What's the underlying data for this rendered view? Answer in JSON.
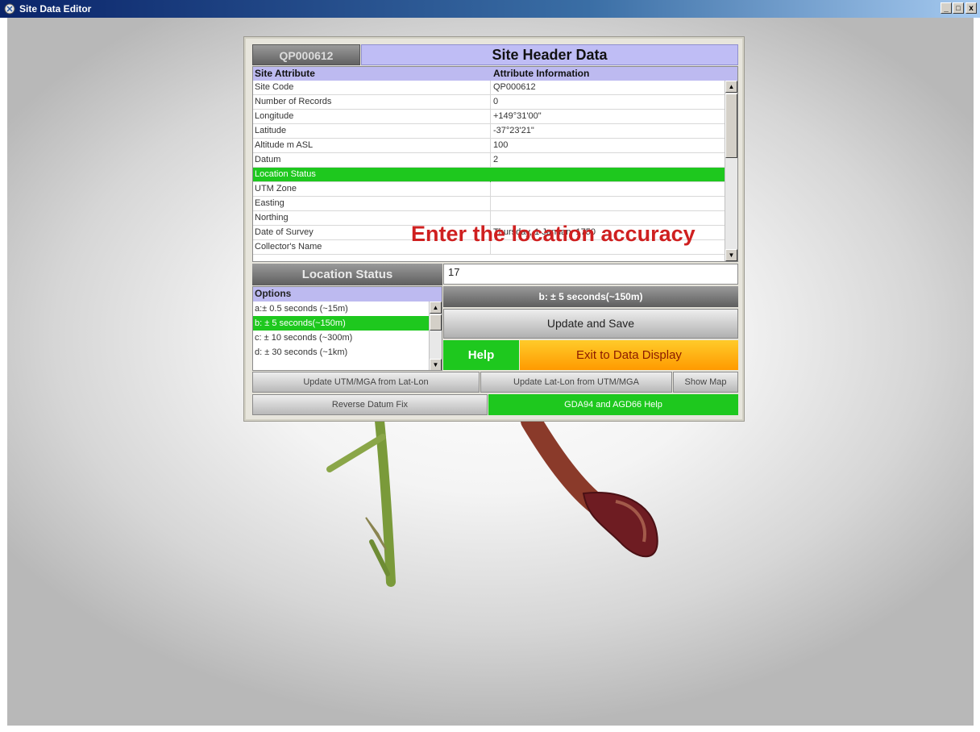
{
  "window": {
    "title": "Site Data Editor",
    "controls": [
      "_",
      "□",
      "x"
    ]
  },
  "header": {
    "site_code": "QP000612",
    "title": "Site Header Data"
  },
  "grid": {
    "columns": [
      "Site Attribute",
      "Attribute Information"
    ],
    "rows": [
      {
        "attribute": "Site Code",
        "value": "QP000612"
      },
      {
        "attribute": "Number of Records",
        "value": "0"
      },
      {
        "attribute": "Longitude",
        "value": "+149°31'00\""
      },
      {
        "attribute": "Latitude",
        "value": "-37°23'21\""
      },
      {
        "attribute": "Altitude m ASL",
        "value": "100"
      },
      {
        "attribute": "Datum",
        "value": "2"
      },
      {
        "attribute": "Location Status",
        "value": "",
        "selected": true
      },
      {
        "attribute": "UTM Zone",
        "value": ""
      },
      {
        "attribute": "Easting",
        "value": ""
      },
      {
        "attribute": "Northing",
        "value": ""
      },
      {
        "attribute": "Date of Survey",
        "value": "Thursday, 1 January 1750"
      },
      {
        "attribute": "Collector's Name",
        "value": ""
      }
    ],
    "prompt": "Enter the location accuracy"
  },
  "location": {
    "label": "Location Status",
    "input_value": "17",
    "options_header": "Options",
    "options": [
      "a:± 0.5 seconds (~15m)",
      "b: ± 5 seconds(~150m)",
      "c: ± 10 seconds (~300m)",
      "d: ± 30 seconds (~1km)"
    ],
    "selected_option_index": 1,
    "selected_display": "b: ± 5 seconds(~150m)"
  },
  "buttons": {
    "update_save": "Update and Save",
    "help": "Help",
    "exit": "Exit to Data Display",
    "update_utm": "Update UTM/MGA from Lat-Lon",
    "update_latlon": "Update Lat-Lon from UTM/MGA",
    "show_map": "Show Map",
    "reverse_datum": "Reverse Datum Fix",
    "gda_help": "GDA94 and AGD66 Help"
  },
  "colors": {
    "header_purple": "#bfbdf5",
    "selection_green": "#1ec81e",
    "prompt_red": "#cf2020",
    "exit_orange": "#ff9a00"
  }
}
